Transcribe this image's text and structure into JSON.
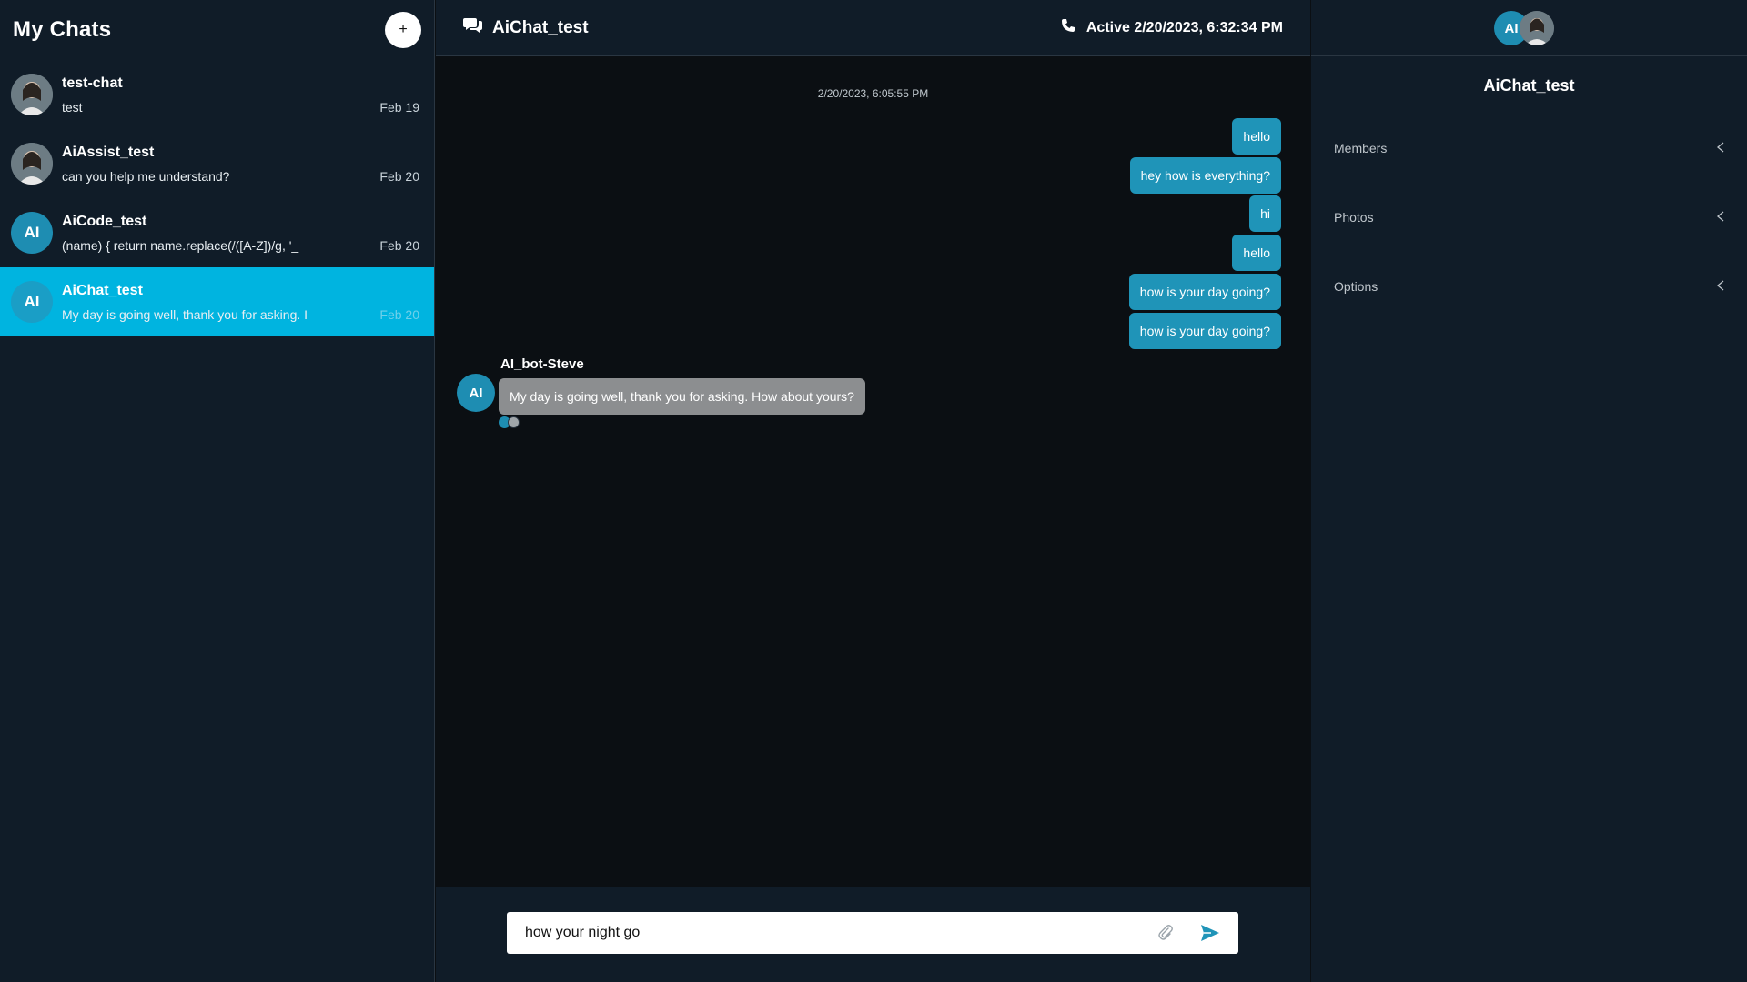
{
  "sidebar": {
    "title": "My Chats",
    "new_chat_label": "+",
    "chats": [
      {
        "name": "test-chat",
        "preview": "test",
        "date": "Feb 19",
        "avatar_type": "photo",
        "avatar_text": ""
      },
      {
        "name": "AiAssist_test",
        "preview": "can you help me understand?",
        "date": "Feb 20",
        "avatar_type": "photo",
        "avatar_text": ""
      },
      {
        "name": "AiCode_test",
        "preview": "(name) { return name.replace(/([A-Z])/g, '_",
        "date": "Feb 20",
        "avatar_type": "initials",
        "avatar_text": "AI"
      },
      {
        "name": "AiChat_test",
        "preview": "My day is going well, thank you for asking. I",
        "date": "Feb 20",
        "avatar_type": "initials",
        "avatar_text": "AI",
        "active": true
      }
    ]
  },
  "header": {
    "title": "AiChat_test",
    "status": "Active 2/20/2023, 6:32:34 PM",
    "chat_icon": "chat-bubbles-icon",
    "phone_icon": "phone-icon"
  },
  "messages": {
    "timestamp": "2/20/2023, 6:05:55 PM",
    "outgoing": [
      "hello",
      "hey how is everything?",
      "hi",
      "hello",
      "how is your day going?",
      "how is your day going?"
    ],
    "bot": {
      "name": "AI_bot-Steve",
      "avatar_text": "AI",
      "text": "My day is going well, thank you for asking. How about yours?"
    }
  },
  "composer": {
    "value": "how your night go",
    "attach_icon": "paperclip-icon",
    "send_icon": "send-icon"
  },
  "details": {
    "title": "AiChat_test",
    "avatar_text": "AI",
    "sections": [
      "Members",
      "Photos",
      "Options"
    ]
  },
  "colors": {
    "accent": "#00b4e0",
    "bubble_out": "#1f94b8",
    "bubble_in": "#8c8e90",
    "panel": "#101c28",
    "background": "#0b0f13"
  }
}
